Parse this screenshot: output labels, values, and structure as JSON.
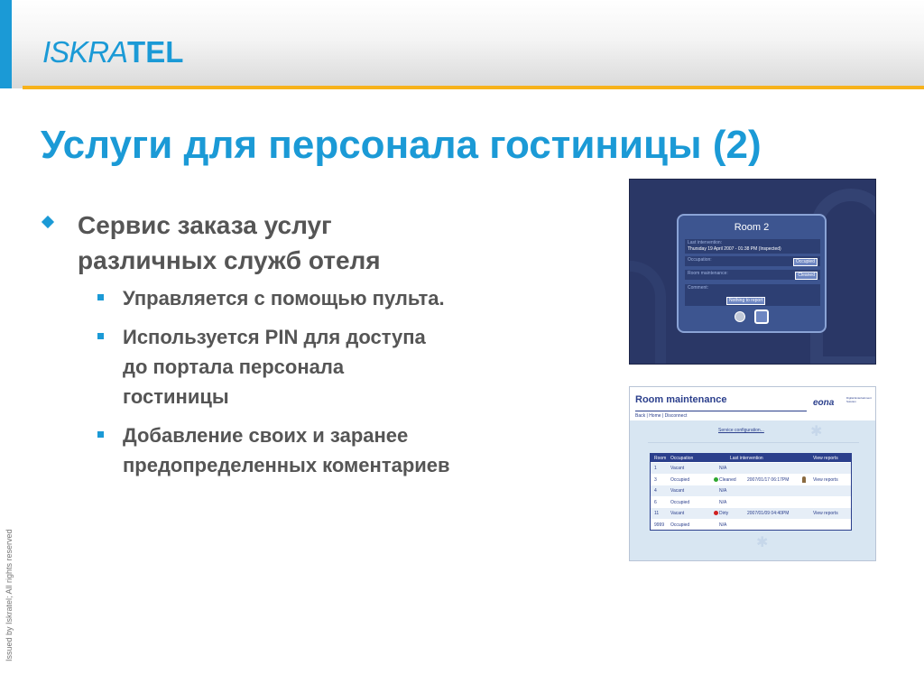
{
  "header": {
    "logo_part1": "ISKRA",
    "logo_part2": "TEL",
    "colors": {
      "accent": "#1b9ad6",
      "rule": "#f7b21b"
    }
  },
  "slide": {
    "title": "Услуги для персонала гостиницы (2)",
    "bullets": [
      {
        "text": "Сервис заказа услуг различных служб отеля",
        "line1": "Сервис заказа услуг",
        "line2": "различных служб отеля",
        "sub": [
          {
            "lines": [
              "Управляется с помощью пульта."
            ]
          },
          {
            "lines": [
              "Используется PIN для доступа",
              "до портала персонала",
              "гостиницы"
            ]
          },
          {
            "lines": [
              "Добавление своих и заранее",
              "предопределенных коментариев"
            ]
          }
        ]
      }
    ],
    "vertical_note": "Issued by Iskratel; All rights reserved"
  },
  "tv_portal": {
    "title": "Room 2",
    "last_intervention_label": "Last intervention:",
    "last_intervention_value": "Thursday 19 April 2007 - 01:38 PM (Inspected)",
    "occupation_label": "Occupation:",
    "occupation_value": "Occupied",
    "maintenance_label": "Room maintenance:",
    "maintenance_value": "Cleaned",
    "comment_label": "Comment:",
    "comment_value": "Nothing to report"
  },
  "web_portal": {
    "title": "Room maintenance",
    "logo": "eona",
    "logo_tagline": "Digital Entertainment Solution",
    "nav": "Back | Home | Disconnect",
    "service_link": "Service configuration...",
    "columns": [
      "Room",
      "Occupation",
      "Last intervention",
      "View reports"
    ],
    "rows": [
      {
        "room": "1",
        "occupation": "Vacant",
        "status": "N/A",
        "status_color": "",
        "date": "",
        "report": ""
      },
      {
        "room": "3",
        "occupation": "Occupied",
        "status": "Cleaned",
        "status_color": "green",
        "date": "2007/01/17 06:17PM",
        "report": "View reports"
      },
      {
        "room": "4",
        "occupation": "Vacant",
        "status": "N/A",
        "status_color": "",
        "date": "",
        "report": ""
      },
      {
        "room": "6",
        "occupation": "Occupied",
        "status": "N/A",
        "status_color": "",
        "date": "",
        "report": ""
      },
      {
        "room": "11",
        "occupation": "Vacant",
        "status": "Dirty",
        "status_color": "red",
        "date": "2007/01/09 04:40PM",
        "report": "View reports"
      },
      {
        "room": "9999",
        "occupation": "Occupied",
        "status": "N/A",
        "status_color": "",
        "date": "",
        "report": ""
      }
    ]
  }
}
